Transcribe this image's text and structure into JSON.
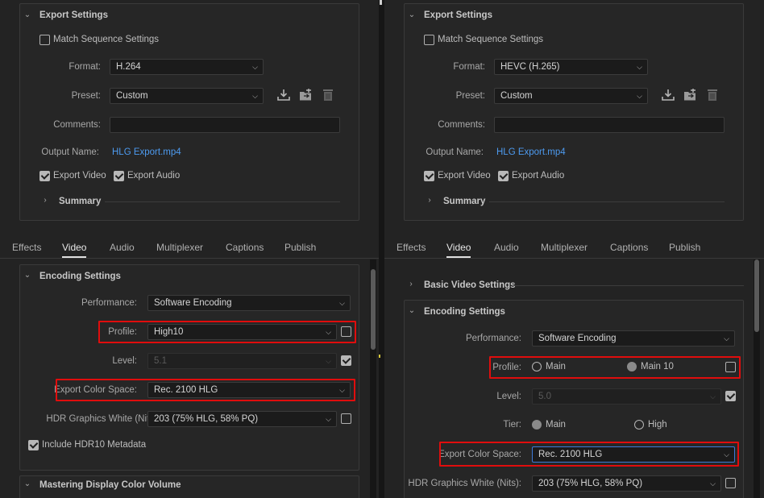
{
  "left": {
    "export_settings": {
      "title": "Export Settings",
      "match_sequence": "Match Sequence Settings",
      "format_label": "Format:",
      "format_value": "H.264",
      "preset_label": "Preset:",
      "preset_value": "Custom",
      "comments_label": "Comments:",
      "output_label": "Output Name:",
      "output_value": "HLG Export.mp4",
      "export_video": "Export Video",
      "export_audio": "Export Audio",
      "summary": "Summary"
    },
    "tabs": [
      "Effects",
      "Video",
      "Audio",
      "Multiplexer",
      "Captions",
      "Publish"
    ],
    "encoding": {
      "title": "Encoding Settings",
      "performance_label": "Performance:",
      "performance_value": "Software Encoding",
      "profile_label": "Profile:",
      "profile_value": "High10",
      "level_label": "Level:",
      "level_value": "5.1",
      "color_space_label": "Export Color Space:",
      "color_space_value": "Rec. 2100 HLG",
      "hdr_white_label": "HDR Graphics White (Nits):",
      "hdr_white_value": "203 (75% HLG, 58% PQ)",
      "hdr10_meta": "Include HDR10 Metadata"
    },
    "mastering_title": "Mastering Display Color Volume"
  },
  "right": {
    "export_settings": {
      "title": "Export Settings",
      "match_sequence": "Match Sequence Settings",
      "format_label": "Format:",
      "format_value": "HEVC (H.265)",
      "preset_label": "Preset:",
      "preset_value": "Custom",
      "comments_label": "Comments:",
      "output_label": "Output Name:",
      "output_value": "HLG Export.mp4",
      "export_video": "Export Video",
      "export_audio": "Export Audio",
      "summary": "Summary"
    },
    "tabs": [
      "Effects",
      "Video",
      "Audio",
      "Multiplexer",
      "Captions",
      "Publish"
    ],
    "basic_video": "Basic Video Settings",
    "encoding": {
      "title": "Encoding Settings",
      "performance_label": "Performance:",
      "performance_value": "Software Encoding",
      "profile_label": "Profile:",
      "profile_main": "Main",
      "profile_main10": "Main 10",
      "level_label": "Level:",
      "level_value": "5.0",
      "tier_label": "Tier:",
      "tier_main": "Main",
      "tier_high": "High",
      "color_space_label": "Export Color Space:",
      "color_space_value": "Rec. 2100 HLG",
      "hdr_white_label": "HDR Graphics White (Nits):",
      "hdr_white_value": "203 (75% HLG, 58% PQ)"
    }
  },
  "colors": {
    "highlight": "#e00d0d",
    "link": "#4d9bf0",
    "background": "#232323"
  }
}
